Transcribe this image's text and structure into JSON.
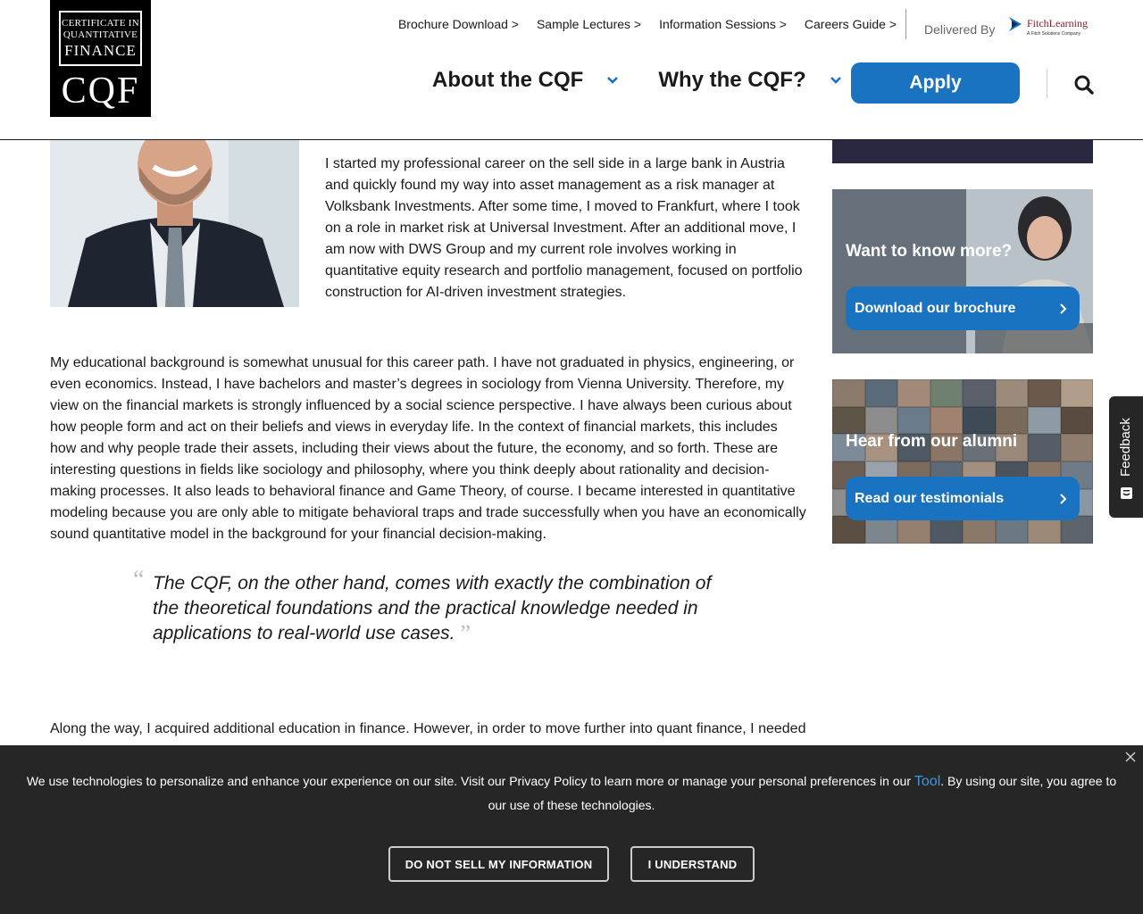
{
  "header": {
    "logo": {
      "line1": "CERTIFICATE IN",
      "line2": "QUANTITATIVE",
      "line3": "FINANCE",
      "mark": "CQF"
    },
    "top_links": [
      "Brochure Download >",
      "Sample Lectures >",
      "Information Sessions >",
      "Careers Guide >"
    ],
    "delivered_by": "Delivered By",
    "partner": {
      "name": "FitchLearning",
      "sub": "A Fitch Solutions Company",
      "color": "#8b1a2a"
    },
    "nav": {
      "about": "About the CQF",
      "why": "Why the CQF?",
      "apply": "Apply"
    },
    "icons": [
      "chevron-down-icon",
      "search-icon"
    ],
    "accent_color": "#1a73c1"
  },
  "article": {
    "para1": "I started my professional career on the sell side in a large bank in Austria and quickly found my way into asset management as a risk manager at Volksbank Investments. After some time, I moved to Frankfurt, where I took on a role in market risk at Universal Investment. After an additional move, I am now with DWS Group and my current role involves working in quantitative equity research and portfolio management, focused on portfolio construction for AI-driven investment strategies.",
    "para2": "My educational background is somewhat unusual for this career path. I have not graduated in physics, engineering, or even economics. Instead, I have bachelors and master’s degrees in sociology from Vienna University. Therefore, my view on the financial markets is strongly influenced by a social science perspective. I have always been curious about how people form and act on their beliefs and views in everyday life. In the context of financial markets, this includes how and why people trade their assets, including their views about the future, the economy, and so forth. These are interesting questions in fields like sociology and philosophy, where you think deeply about rationality and decision-making processes. It also leads to behavioral finance and Game Theory, of course. I became interested in quantitative modeling because you are only able to mitigate behavioral traps and trade successfully when you have an economically sound quantitative model in the background for your financial decision-making.",
    "quote": "The CQF, on the other hand, comes with exactly the combination of the theoretical foundations and the practical knowledge needed in applications to real-world use cases.",
    "quote_open": "“",
    "quote_close": "”",
    "para3": "Along the way, I acquired additional education in finance. However, in order to move further into quant finance, I needed"
  },
  "sidebar": {
    "card1": {
      "title": "Want to know more?",
      "button": "Download our brochure"
    },
    "card2": {
      "title": "Hear from our alumni",
      "button": "Read our testimonials"
    }
  },
  "feedback": {
    "label": "Feedback"
  },
  "cookie": {
    "text_before": "We use technologies to personalize and enhance your experience on our site. Visit our Privacy Policy to learn more or manage your personal preferences in our ",
    "tool_link": "Tool",
    "text_after": ". By using our site, you agree to our use of these technologies.",
    "btn_do_not_sell": "DO NOT SELL MY INFORMATION",
    "btn_understand": "I UNDERSTAND"
  }
}
